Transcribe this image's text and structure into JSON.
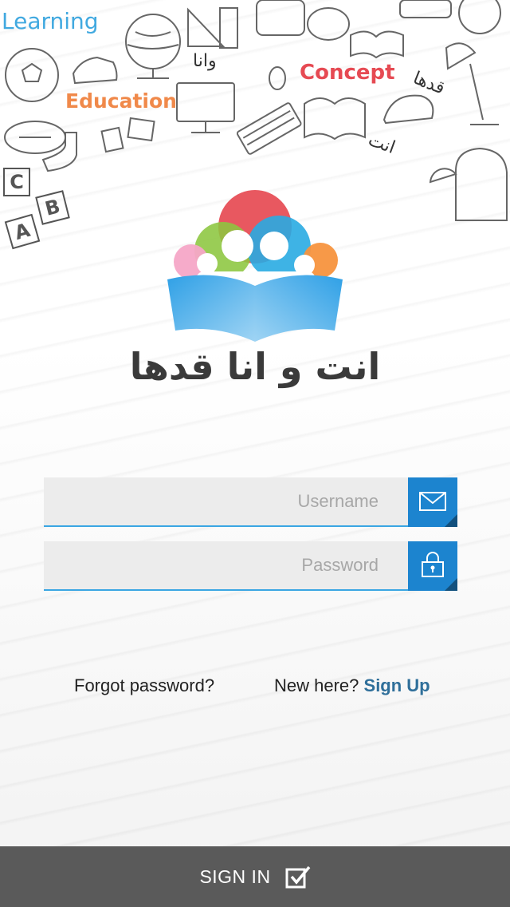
{
  "header": {
    "doodle_words": {
      "learning": "Learning",
      "education": "Education",
      "concept": "Concept",
      "arabic_1": "وانا",
      "arabic_2": "قدها",
      "arabic_3": "انت"
    },
    "letters": [
      "C",
      "B",
      "A"
    ]
  },
  "logo": {
    "name": "انت و انا قدها",
    "colors": {
      "red": "#e64a53",
      "green": "#8cc63f",
      "blue": "#29abe2",
      "pink": "#f5a7c7",
      "orange": "#f7943e",
      "book": "#1c84cf"
    }
  },
  "login_form": {
    "username": {
      "placeholder": "Username",
      "icon": "envelope-icon"
    },
    "password": {
      "placeholder": "Password",
      "icon": "lock-icon"
    }
  },
  "links": {
    "forgot_password": "Forgot password?",
    "new_here": "New here?",
    "sign_up": "Sign Up"
  },
  "footer": {
    "sign_in": "SIGN IN",
    "icon": "checkbox-check-icon"
  },
  "colors": {
    "accent": "#1c84cf",
    "footer_bg": "#5a5a5a",
    "link": "#2f6f9a"
  }
}
